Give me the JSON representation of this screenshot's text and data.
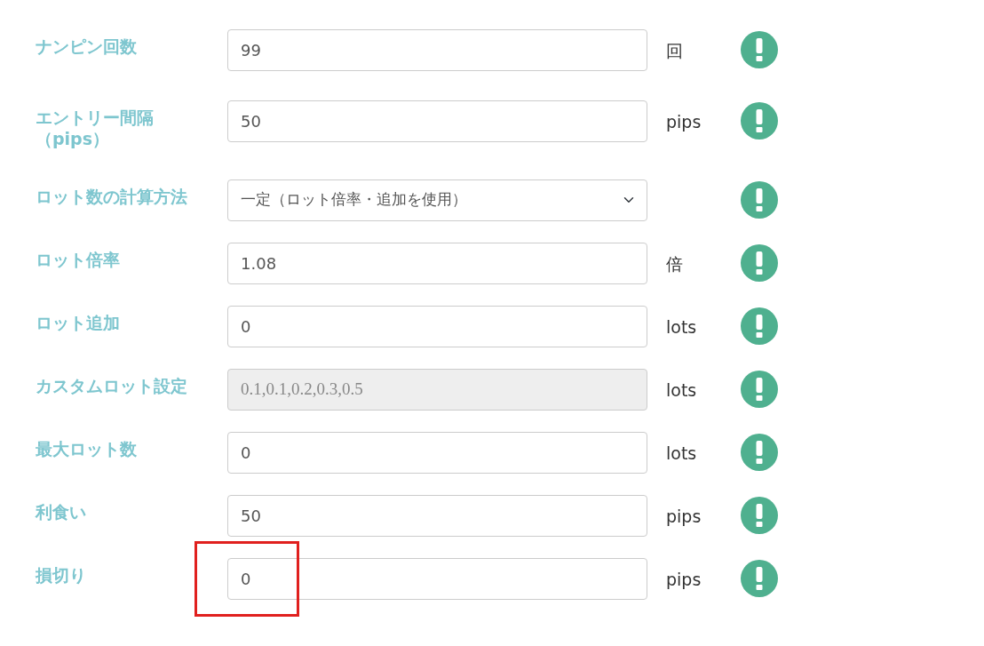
{
  "settings": [
    {
      "label": "ナンピン回数",
      "kind": "input",
      "value": "99",
      "unit": "回",
      "disabled": false,
      "highlighted": false
    },
    {
      "label": "エントリー間隔（pips）",
      "kind": "input",
      "value": "50",
      "unit": "pips",
      "disabled": false,
      "highlighted": false
    },
    {
      "label": "ロット数の計算方法",
      "kind": "select",
      "value": "一定（ロット倍率・追加を使用）",
      "disabled": false,
      "highlighted": false
    },
    {
      "label": "ロット倍率",
      "kind": "input",
      "value": "1.08",
      "unit": "倍",
      "disabled": false,
      "highlighted": false
    },
    {
      "label": "ロット追加",
      "kind": "input",
      "value": "0",
      "unit": "lots",
      "disabled": false,
      "highlighted": false
    },
    {
      "label": "カスタムロット設定",
      "kind": "input",
      "value": "0.1,0.1,0.2,0.3,0.5",
      "unit": "lots",
      "disabled": true,
      "highlighted": false
    },
    {
      "label": "最大ロット数",
      "kind": "input",
      "value": "0",
      "unit": "lots",
      "disabled": false,
      "highlighted": false
    },
    {
      "label": "利食い",
      "kind": "input",
      "value": "50",
      "unit": "pips",
      "disabled": false,
      "highlighted": false
    },
    {
      "label": "損切り",
      "kind": "input",
      "value": "0",
      "unit": "pips",
      "disabled": false,
      "highlighted": true
    }
  ]
}
